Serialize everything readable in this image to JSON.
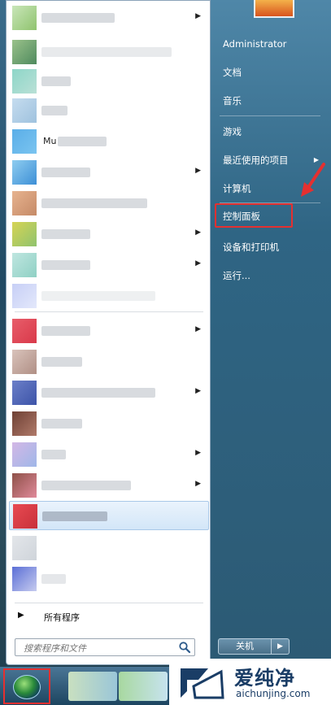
{
  "user": {
    "name": "Administrator"
  },
  "right_menu": {
    "items": [
      {
        "label": "文档",
        "has_submenu": false
      },
      {
        "label": "音乐",
        "has_submenu": false
      },
      {
        "label": "游戏",
        "has_submenu": false
      },
      {
        "label": "最近使用的项目",
        "has_submenu": true
      },
      {
        "label": "计算机",
        "has_submenu": false
      },
      {
        "label": "控制面板",
        "has_submenu": false,
        "highlighted": true
      },
      {
        "label": "设备和打印机",
        "has_submenu": false
      },
      {
        "label": "运行...",
        "has_submenu": false
      }
    ]
  },
  "left_menu": {
    "programs_visible_text": [
      "Mu"
    ],
    "all_programs_label": "所有程序",
    "search_placeholder": "搜索程序和文件"
  },
  "power": {
    "shutdown_label": "关机"
  },
  "watermark": {
    "name": "爱纯净",
    "url": "aichunjing.com"
  },
  "colors": {
    "highlight_box": "#e53030",
    "right_pane": "#2f6584",
    "watermark_text": "#1a3d66"
  },
  "icons": [
    "windows-orb-icon",
    "search-icon",
    "submenu-arrow-icon",
    "red-pointer-arrow-icon",
    "watermark-logo-icon"
  ]
}
